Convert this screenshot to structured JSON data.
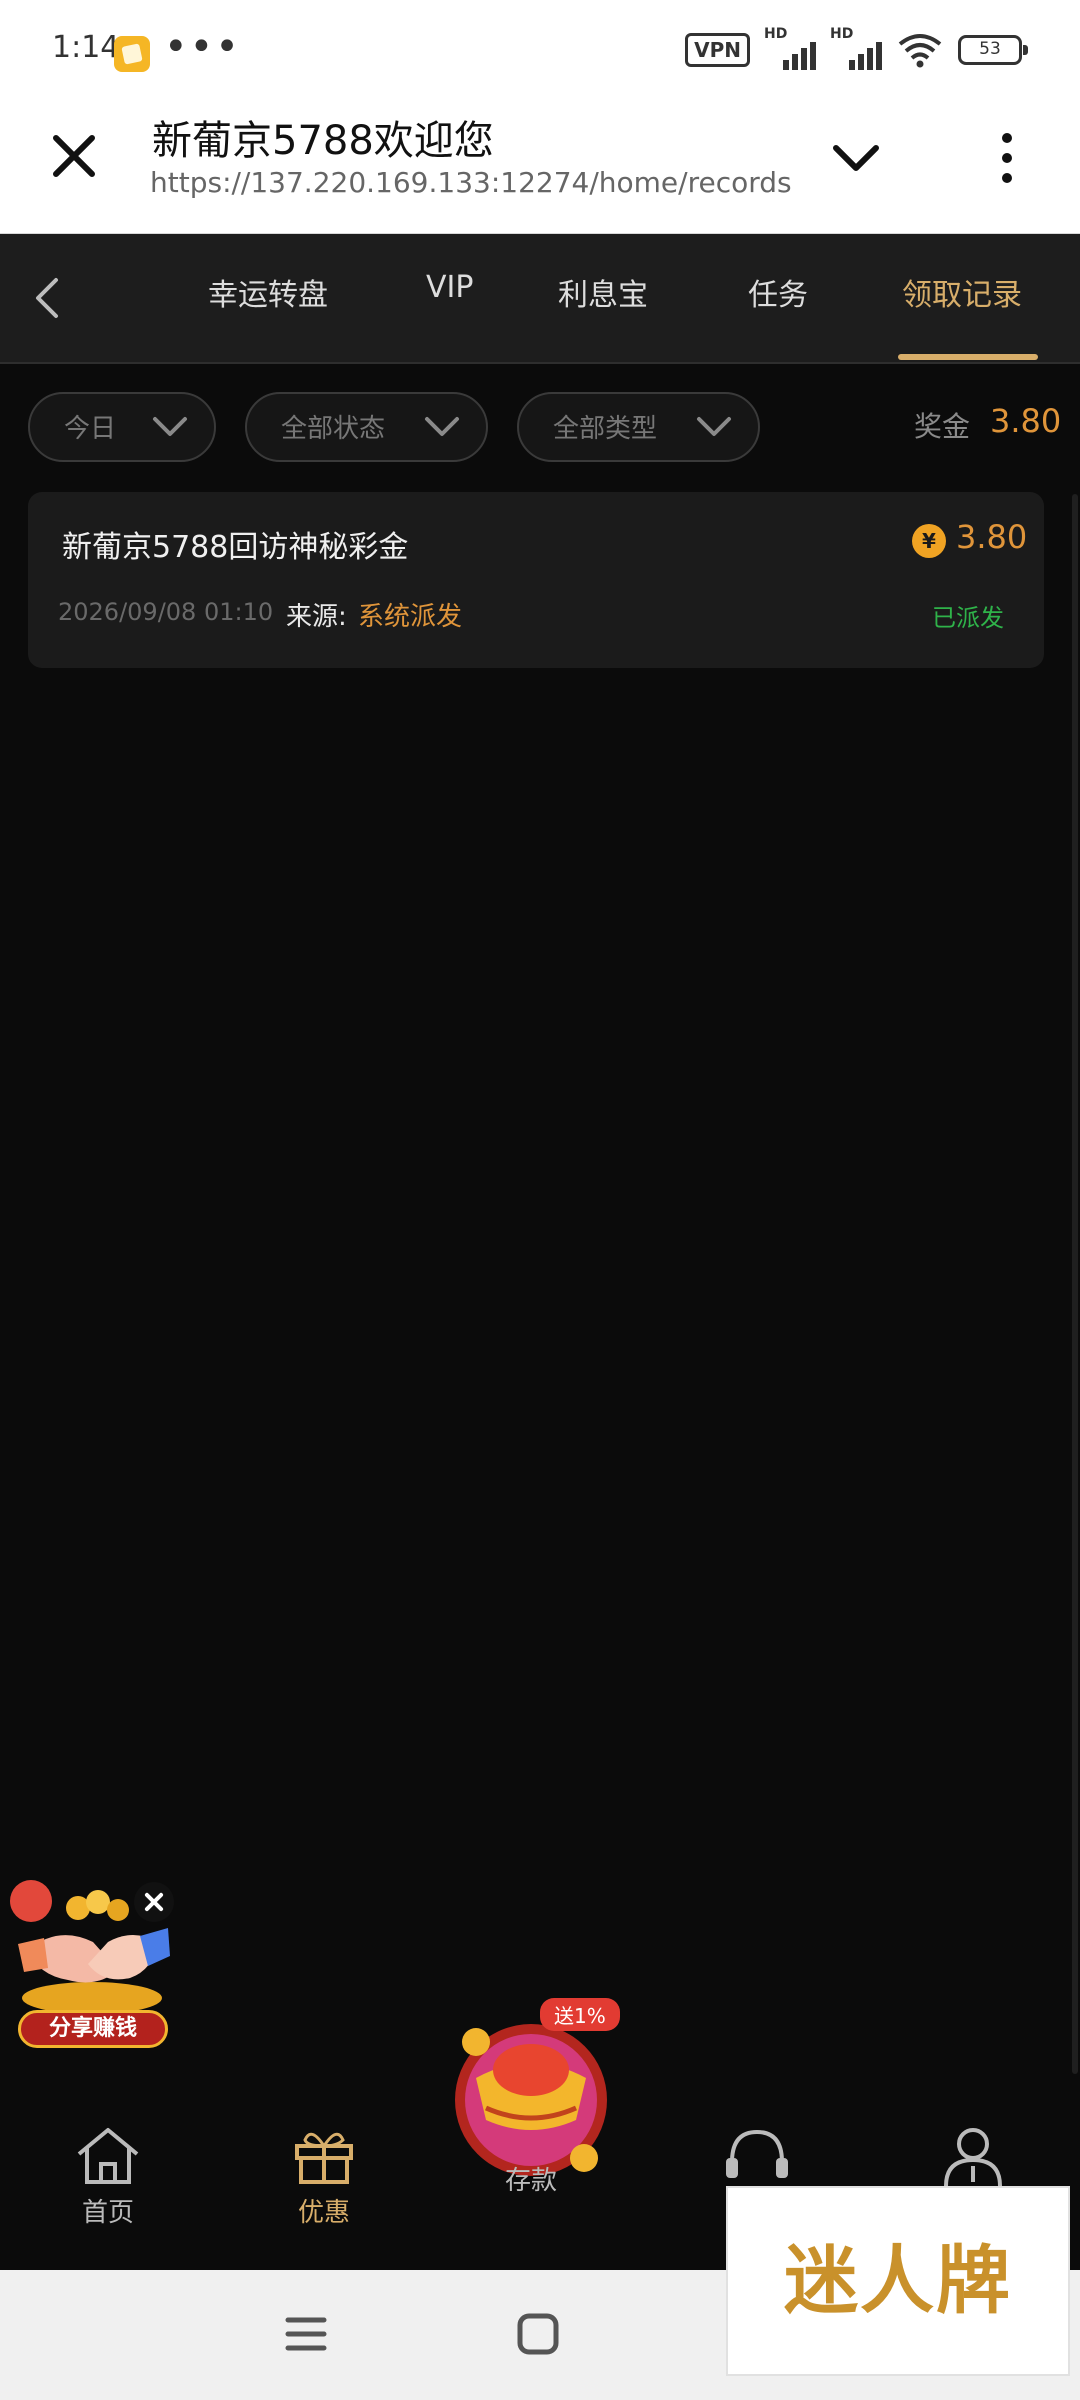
{
  "status_bar": {
    "time": "1:14",
    "vpn": "VPN",
    "hd1": "HD",
    "hd2": "HD",
    "battery": "53"
  },
  "browser": {
    "title": "新葡京5788欢迎您",
    "url": "https://137.220.169.133:12274/home/records"
  },
  "tabs": [
    {
      "label": "幸运转盘"
    },
    {
      "label": "VIP"
    },
    {
      "label": "利息宝"
    },
    {
      "label": "任务"
    },
    {
      "label": "领取记录",
      "active": true
    }
  ],
  "filters": {
    "date": "今日",
    "status": "全部状态",
    "type": "全部类型",
    "bonus_label": "奖金",
    "bonus_total": "3.80"
  },
  "records": [
    {
      "title": "新葡京5788回访神秘彩金",
      "amount": "3.80",
      "coin_symbol": "¥",
      "datetime": "2026/09/08 01:10",
      "source_label": "来源:",
      "source_value": "系统派发",
      "status": "已派发"
    }
  ],
  "share_widget": {
    "label": "分享赚钱"
  },
  "bottom_nav": {
    "home": "首页",
    "promotions": "优惠",
    "deposit": "存款",
    "deposit_tag": "送1%"
  },
  "watermark": "迷人牌",
  "colors": {
    "accent_gold": "#d8ae6a",
    "amount_orange": "#e0953a",
    "status_green": "#2fb34a",
    "background": "#0b0b0b"
  }
}
